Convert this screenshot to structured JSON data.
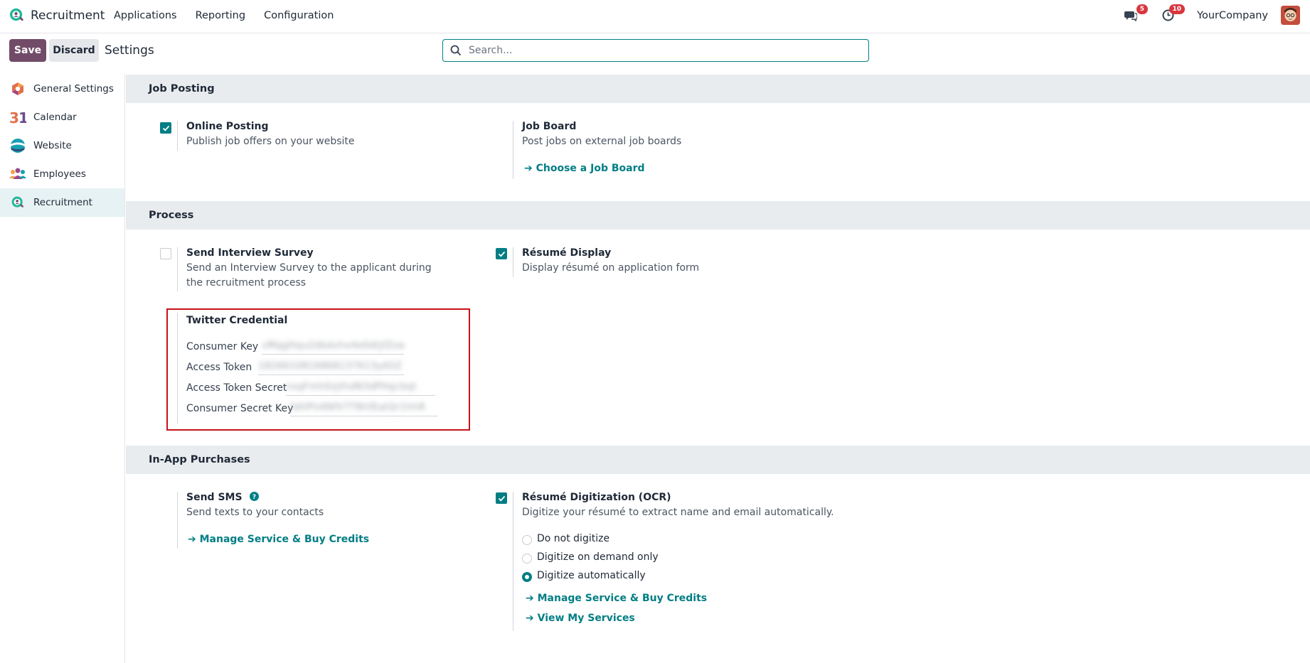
{
  "navbar": {
    "app_name": "Recruitment",
    "menu": [
      "Applications",
      "Reporting",
      "Configuration"
    ],
    "messages_badge": "5",
    "activities_badge": "10",
    "company": "YourCompany"
  },
  "control_panel": {
    "save_label": "Save",
    "discard_label": "Discard",
    "title": "Settings",
    "search_placeholder": "Search..."
  },
  "sidebar": {
    "items": [
      {
        "label": "General Settings",
        "icon": "general-settings-icon"
      },
      {
        "label": "Calendar",
        "icon": "calendar-icon"
      },
      {
        "label": "Website",
        "icon": "website-icon"
      },
      {
        "label": "Employees",
        "icon": "employees-icon"
      },
      {
        "label": "Recruitment",
        "icon": "recruitment-icon",
        "active": true
      }
    ]
  },
  "sections": {
    "job_posting": {
      "title": "Job Posting",
      "online_posting": {
        "title": "Online Posting",
        "desc": "Publish job offers on your website",
        "checked": true
      },
      "job_board": {
        "title": "Job Board",
        "desc": "Post jobs on external job boards",
        "link": "Choose a Job Board"
      }
    },
    "process": {
      "title": "Process",
      "interview_survey": {
        "title": "Send Interview Survey",
        "desc": "Send an Interview Survey to the applicant during the recruitment process",
        "checked": false
      },
      "resume_display": {
        "title": "Résumé Display",
        "desc": "Display résumé on application form",
        "checked": true
      },
      "twitter": {
        "title": "Twitter Credential",
        "consumer_key_label": "Consumer Key",
        "consumer_key_value": "vMqgHqu2dbdvhx4e0dtjfZoa",
        "access_token_label": "Access Token",
        "access_token_value": "1826610816868137613yA5Z",
        "access_token_secret_label": "Access Token Secret",
        "access_token_secret_value": "nsqFmh0zjthdN3dPHqcbqt",
        "consumer_secret_label": "Consumer Secret Key",
        "consumer_secret_value": "fdtIPU4NfV7T8hfEatQr1hhR"
      }
    },
    "in_app": {
      "title": "In-App Purchases",
      "sms": {
        "title": "Send SMS",
        "desc": "Send texts to your contacts",
        "link": "Manage Service & Buy Credits"
      },
      "ocr": {
        "title": "Résumé Digitization (OCR)",
        "desc": "Digitize your résumé to extract name and email automatically.",
        "checked": true,
        "options": [
          "Do not digitize",
          "Digitize on demand only",
          "Digitize automatically"
        ],
        "selected": "Digitize automatically",
        "link_manage": "Manage Service & Buy Credits",
        "link_services": "View My Services"
      }
    }
  }
}
